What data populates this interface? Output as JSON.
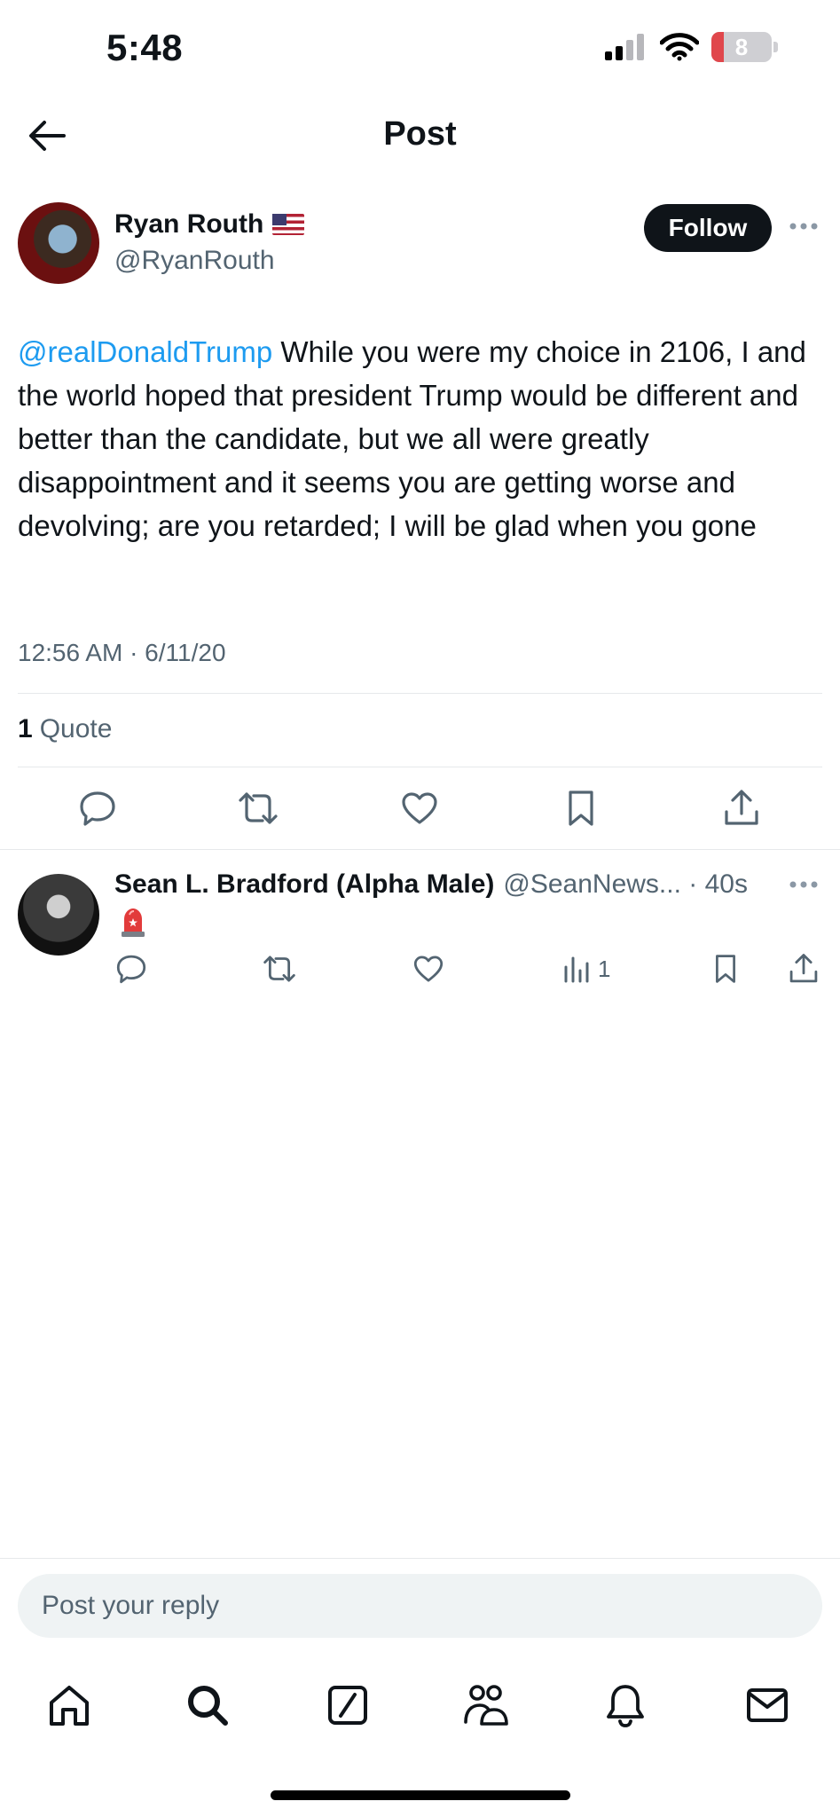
{
  "status_bar": {
    "time": "5:48",
    "battery": "8"
  },
  "header": {
    "title": "Post"
  },
  "post": {
    "author_name": "Ryan Routh",
    "author_handle": "@RyanRouth",
    "follow_label": "Follow",
    "mention": "@realDonaldTrump",
    "body": " While you were my choice in 2106, I and the world hoped that president Trump would be different and better than the candidate, but we all were greatly disappointment and it seems you are getting worse and devolving; are you retarded; I will be glad when you gone",
    "timestamp": "12:56 AM · 6/11/20",
    "quote_count": "1",
    "quote_label": "Quote"
  },
  "reply": {
    "author_name": "Sean L. Bradford (Alpha Male)",
    "author_handle": "@SeanNews... · 40s",
    "views": "1"
  },
  "composer": {
    "placeholder": "Post your reply"
  },
  "icons": {
    "back": "arrow-left-icon",
    "more": "more-horizontal-icon",
    "actions": [
      "reply-icon",
      "repost-icon",
      "like-icon",
      "bookmark-icon",
      "share-icon"
    ],
    "views": "views-icon",
    "nav": [
      "home-icon",
      "search-icon",
      "grok-icon",
      "communities-icon",
      "notifications-icon",
      "messages-icon"
    ]
  },
  "colors": {
    "link": "#1d9bf0",
    "secondary_text": "#536471",
    "primary_text": "#0f1419",
    "follow_bg": "#0f1419"
  }
}
